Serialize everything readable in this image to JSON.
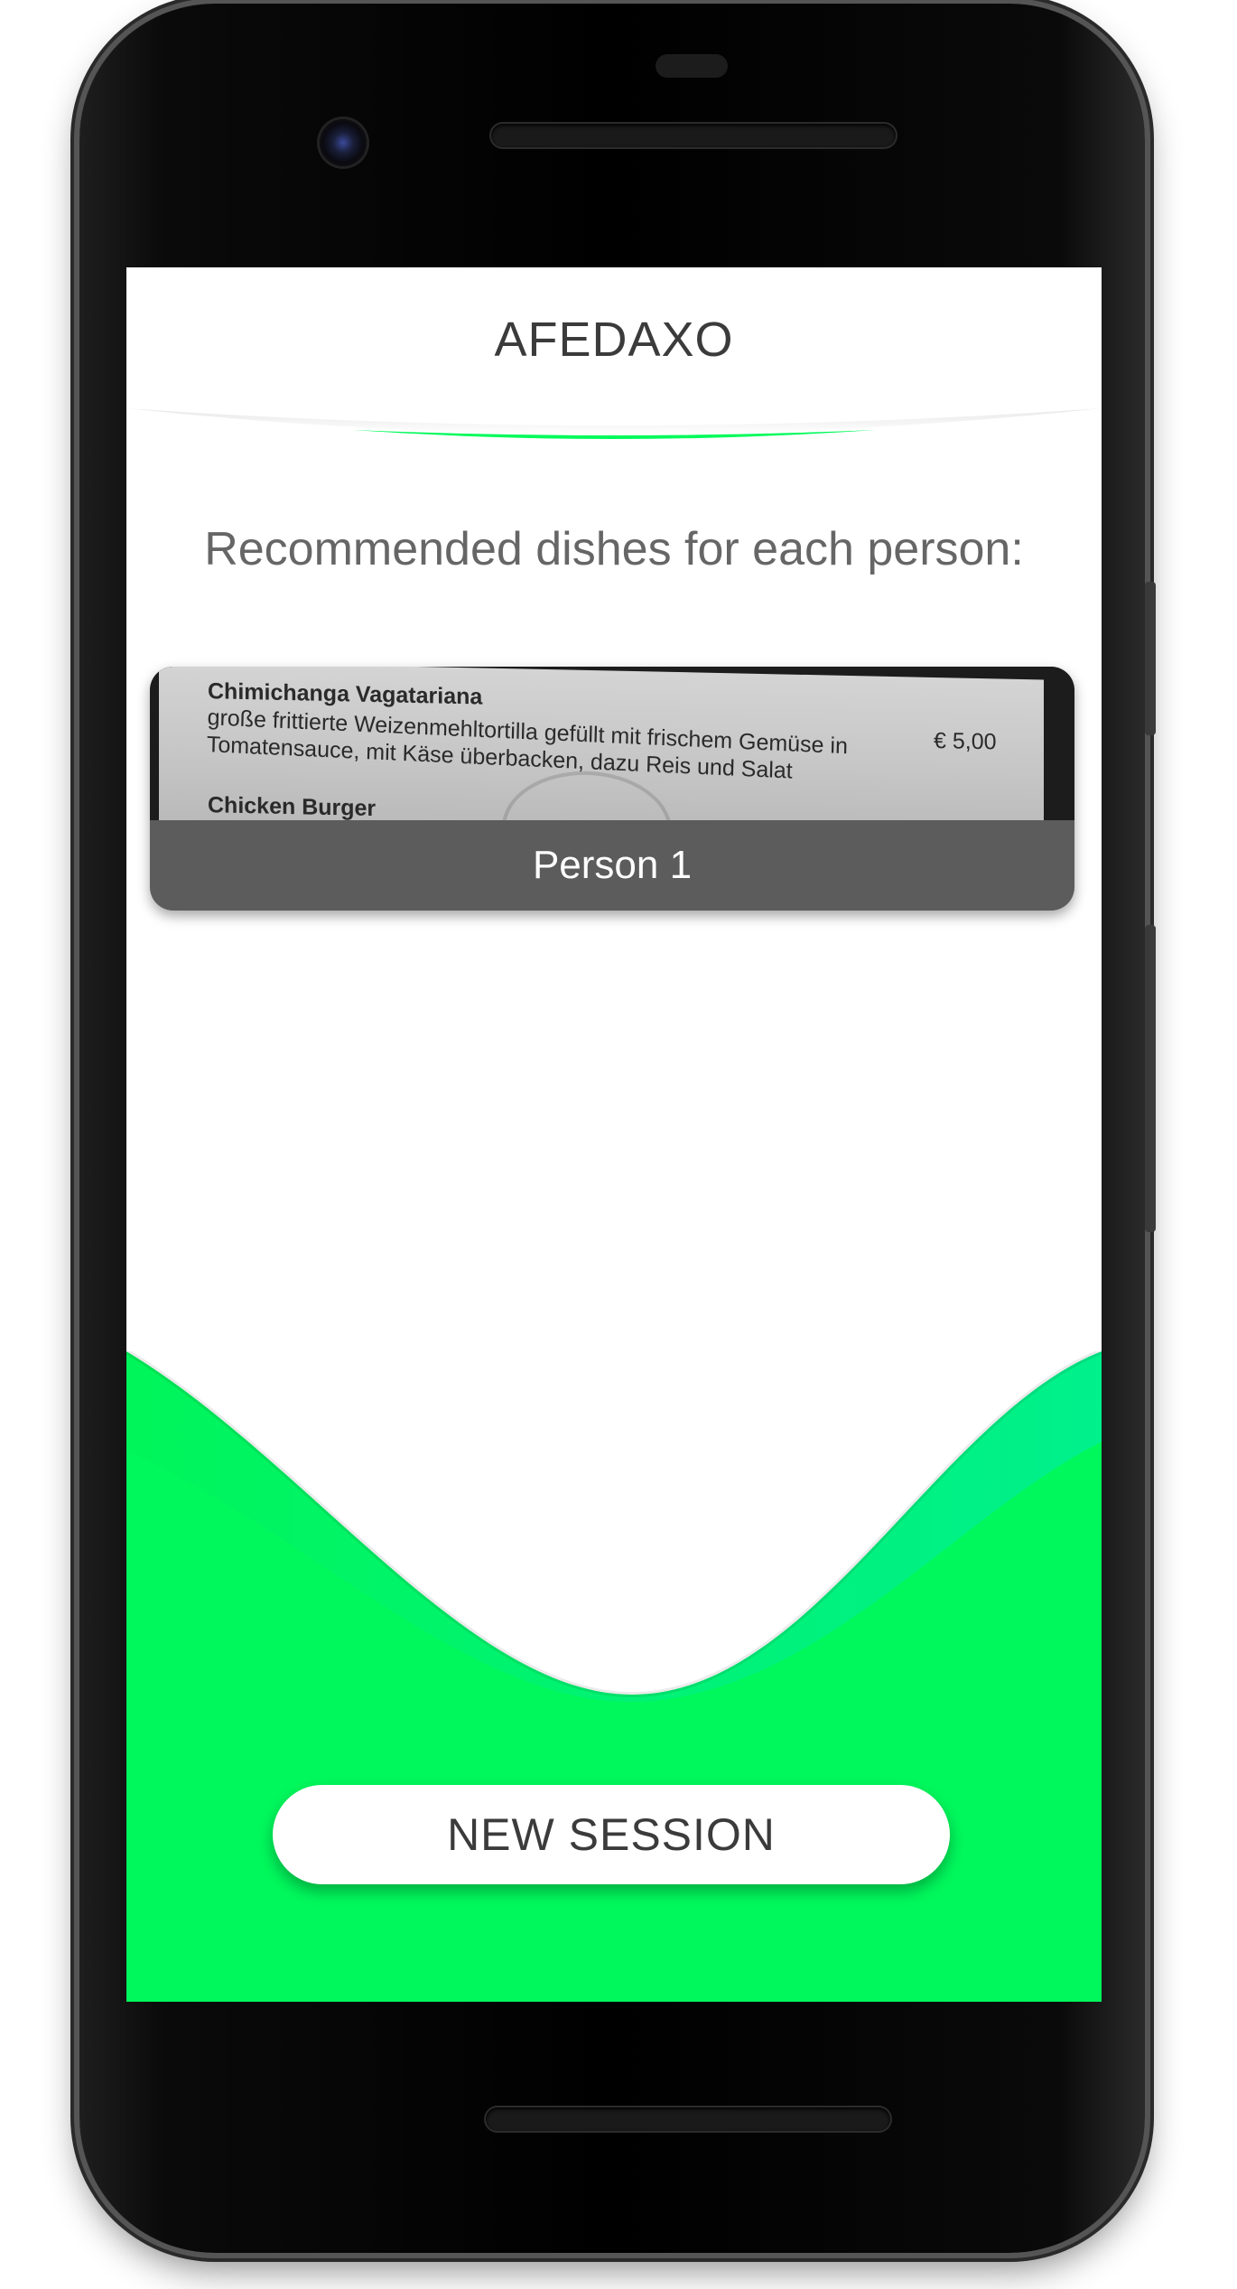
{
  "app": {
    "title": "AFEDAXO"
  },
  "main": {
    "subtitle": "Recommended dishes for each person:"
  },
  "recommendations": [
    {
      "person_label": "Person 1",
      "menu_photo": {
        "dish_name": "Chimichanga Vagatariana",
        "description": "große frittierte Weizenmehltortilla gefüllt mit frischem Gemüse in Tomatensauce, mit Käse überbacken, dazu Reis und Salat",
        "price": "€ 5,00",
        "next_dish": "Chicken Burger"
      }
    }
  ],
  "actions": {
    "new_session_label": "NEW SESSION"
  },
  "colors": {
    "accent": "#00FA5A",
    "card_label_bg": "#5C5C5C",
    "text_dark": "#3B3B3B",
    "text_muted": "#666666"
  },
  "icons": {
    "camera": "front-camera-icon"
  }
}
